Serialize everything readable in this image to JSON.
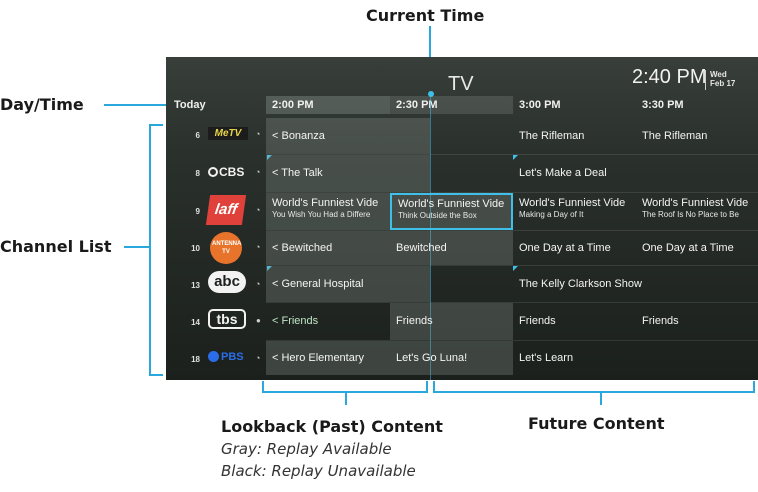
{
  "annotations": {
    "current_time": "Current Time",
    "day_time": "Day/Time",
    "channel_list": "Channel List",
    "lookback": "Lookback (Past) Content",
    "lookback_gray": "Gray: Replay Available",
    "lookback_black": "Black: Replay Unavailable",
    "future": "Future Content"
  },
  "screen": {
    "title": "TV",
    "time": "2:40 PM",
    "day": "Wed",
    "date": "Feb 17"
  },
  "header": {
    "today": "Today",
    "slots": [
      "2:00 PM",
      "2:30 PM",
      "3:00 PM",
      "3:30 PM"
    ]
  },
  "channels": [
    {
      "num": "6",
      "logo": "MeTV",
      "cells": [
        {
          "title": "< Bonanza",
          "sub": ""
        },
        {
          "title": "The Rifleman",
          "sub": ""
        },
        {
          "title": "The Rifleman",
          "sub": ""
        }
      ]
    },
    {
      "num": "8",
      "logo": "CBS",
      "cells": [
        {
          "title": "< The Talk",
          "sub": ""
        },
        {
          "title": "Let's Make a Deal",
          "sub": ""
        }
      ]
    },
    {
      "num": "9",
      "logo": "laff",
      "cells": [
        {
          "title": "World's Funniest Vide",
          "sub": "You Wish You Had a Differe"
        },
        {
          "title": "World's Funniest Vide",
          "sub": "Think Outside the Box"
        },
        {
          "title": "World's Funniest Vide",
          "sub": "Making a Day of It"
        },
        {
          "title": "World's Funniest Vide",
          "sub": "The Roof Is No Place to Be"
        }
      ]
    },
    {
      "num": "10",
      "logo": "ANTENNA TV",
      "cells": [
        {
          "title": "< Bewitched",
          "sub": ""
        },
        {
          "title": "Bewitched",
          "sub": ""
        },
        {
          "title": "One Day at a Time",
          "sub": ""
        },
        {
          "title": "One Day at a Time",
          "sub": ""
        }
      ]
    },
    {
      "num": "13",
      "logo": "abc",
      "cells": [
        {
          "title": "< General Hospital",
          "sub": ""
        },
        {
          "title": "The Kelly Clarkson Show",
          "sub": ""
        }
      ]
    },
    {
      "num": "14",
      "logo": "tbs",
      "cells": [
        {
          "title": "< Friends",
          "sub": ""
        },
        {
          "title": "Friends",
          "sub": ""
        },
        {
          "title": "Friends",
          "sub": ""
        },
        {
          "title": "Friends",
          "sub": ""
        }
      ]
    },
    {
      "num": "18",
      "logo": "PBS",
      "cells": [
        {
          "title": "< Hero Elementary",
          "sub": ""
        },
        {
          "title": "Let's Go Luna!",
          "sub": ""
        },
        {
          "title": "Let's Learn",
          "sub": ""
        }
      ]
    }
  ]
}
